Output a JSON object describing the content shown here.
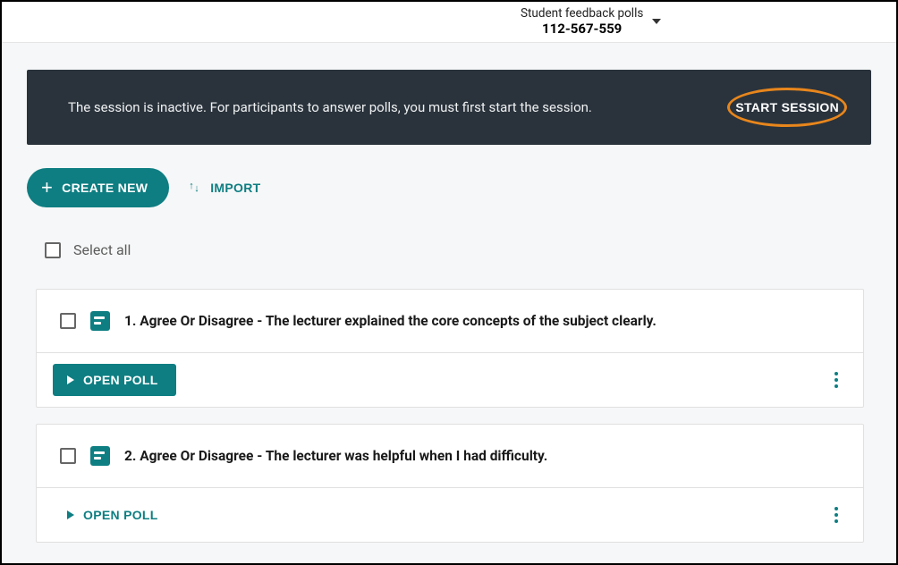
{
  "header": {
    "session_title": "Student feedback polls",
    "session_code": "112-567-559"
  },
  "banner": {
    "message": "The session is inactive. For participants to answer polls, you must first start the session.",
    "start_label": "START SESSION"
  },
  "toolbar": {
    "create_label": "CREATE NEW",
    "import_label": "IMPORT"
  },
  "select_all_label": "Select all",
  "polls": [
    {
      "title": "1. Agree Or Disagree - The lecturer explained the core concepts of the subject clearly.",
      "open_label": "OPEN POLL",
      "open_style": "filled"
    },
    {
      "title": "2. Agree Or Disagree - The lecturer was helpful when I had difficulty.",
      "open_label": "OPEN POLL",
      "open_style": "text"
    }
  ]
}
